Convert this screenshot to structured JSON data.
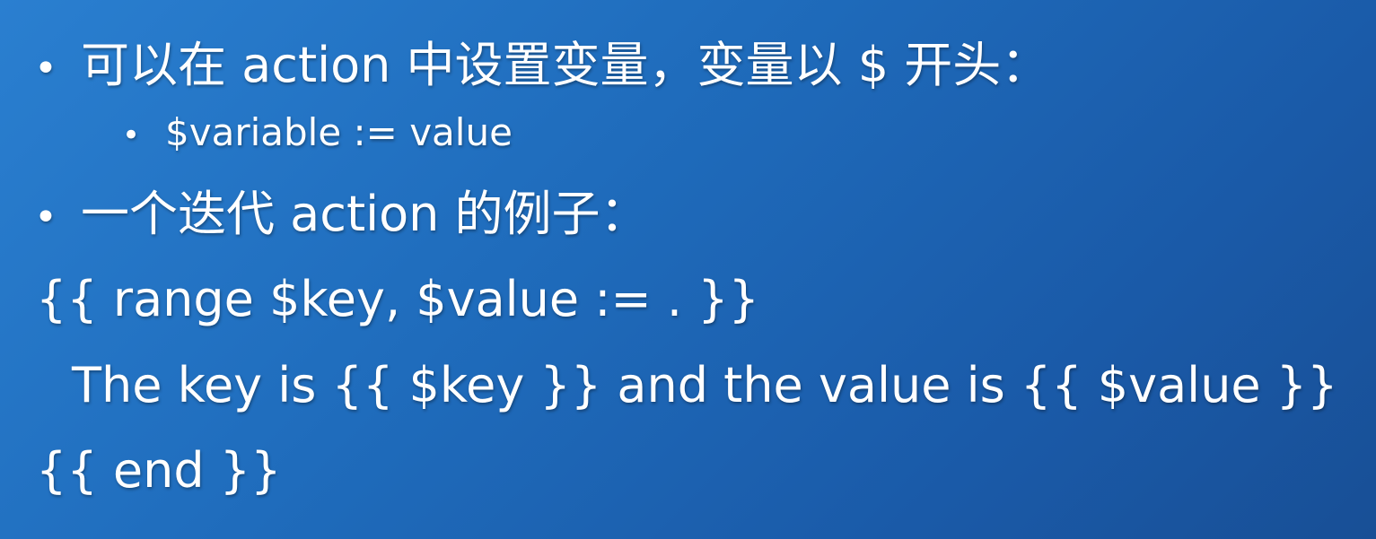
{
  "slide": {
    "bullet_char": "•",
    "items": [
      {
        "text": "可以在 action 中设置变量，变量以 $ 开头："
      },
      {
        "text": "$variable := value"
      },
      {
        "text": "一个迭代 action 的例子："
      }
    ],
    "code_lines": [
      "{{ range $key, $value := . }}",
      "The key is {{ $key }} and the value is {{ $value }}",
      "{{ end }}"
    ]
  }
}
